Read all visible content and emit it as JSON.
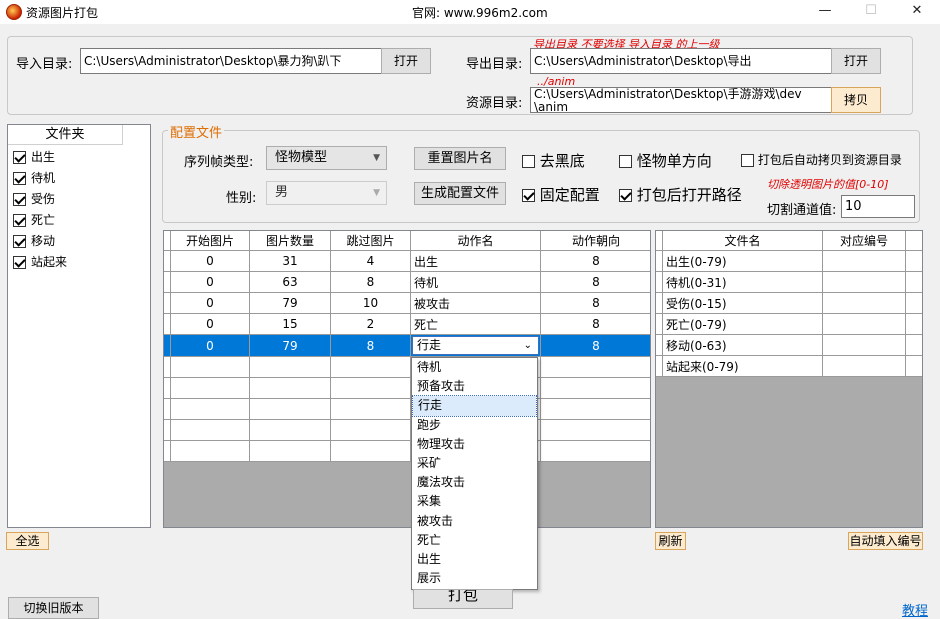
{
  "window": {
    "title": "资源图片打包",
    "site": "官网: www.996m2.com",
    "minimize": "—",
    "maximize": "☐",
    "close": "✕"
  },
  "top": {
    "import_label": "导入目录:",
    "import_value": "C:\\Users\\Administrator\\Desktop\\暴力狗\\趴下",
    "import_button": "打开",
    "export_note": "导出目录 不要选择 导入目录 的上一级",
    "export_label": "导出目录:",
    "export_value": "C:\\Users\\Administrator\\Desktop\\导出",
    "export_button": "打开",
    "resource_note": "../anim",
    "resource_label": "资源目录:",
    "resource_value_line1": "C:\\Users\\Administrator\\Desktop\\手游游戏\\dev",
    "resource_value_line2": "\\anim",
    "resource_button": "拷贝"
  },
  "folder_panel": {
    "header": "文件夹",
    "items": [
      {
        "label": "出生",
        "checked": true
      },
      {
        "label": "待机",
        "checked": true
      },
      {
        "label": "受伤",
        "checked": true
      },
      {
        "label": "死亡",
        "checked": true
      },
      {
        "label": "移动",
        "checked": true
      },
      {
        "label": "站起来",
        "checked": true
      }
    ],
    "select_all": "全选"
  },
  "config": {
    "group_title": "配置文件",
    "frame_type_label": "序列帧类型:",
    "frame_type_value": "怪物模型",
    "gender_label": "性别:",
    "gender_value": "男",
    "rename_button": "重置图片名",
    "generate_button": "生成配置文件",
    "remove_black": {
      "label": "去黑底",
      "checked": false
    },
    "monster_single_dir": {
      "label": "怪物单方向",
      "checked": false
    },
    "auto_copy": {
      "label": "打包后自动拷贝到资源目录",
      "checked": false
    },
    "fixed_config": {
      "label": "固定配置",
      "checked": true
    },
    "open_path": {
      "label": "打包后打开路径",
      "checked": true
    },
    "trim_note": "切除透明图片的值[0-10]",
    "trim_label": "切割通道值:",
    "trim_value": "10"
  },
  "action_grid": {
    "columns": [
      "开始图片",
      "图片数量",
      "跳过图片",
      "动作名",
      "动作朝向"
    ],
    "rows": [
      [
        "0",
        "31",
        "4",
        "出生",
        "8"
      ],
      [
        "0",
        "63",
        "8",
        "待机",
        "8"
      ],
      [
        "0",
        "79",
        "10",
        "被攻击",
        "8"
      ],
      [
        "0",
        "15",
        "2",
        "死亡",
        "8"
      ]
    ],
    "selected_row": [
      "0",
      "79",
      "8",
      "行走",
      "8"
    ],
    "dropdown_options": [
      "待机",
      "预备攻击",
      "行走",
      "跑步",
      "物理攻击",
      "采矿",
      "魔法攻击",
      "采集",
      "被攻击",
      "死亡",
      "出生",
      "展示"
    ],
    "dropdown_highlighted": "行走"
  },
  "file_grid": {
    "columns": [
      "文件名",
      "对应编号"
    ],
    "rows": [
      [
        "出生(0-79)",
        ""
      ],
      [
        "待机(0-31)",
        ""
      ],
      [
        "受伤(0-15)",
        ""
      ],
      [
        "死亡(0-79)",
        ""
      ],
      [
        "移动(0-63)",
        ""
      ],
      [
        "站起来(0-79)",
        ""
      ]
    ],
    "refresh_button": "刷新",
    "auto_fill_button": "自动填入编号"
  },
  "bottom": {
    "pack_button": "打包",
    "switch_old": "切换旧版本",
    "tutorial": "教程"
  },
  "colors": {
    "selection": "#0078d7",
    "note_red": "#e00000",
    "group_title": "#e06c00",
    "link": "#0066cc"
  }
}
